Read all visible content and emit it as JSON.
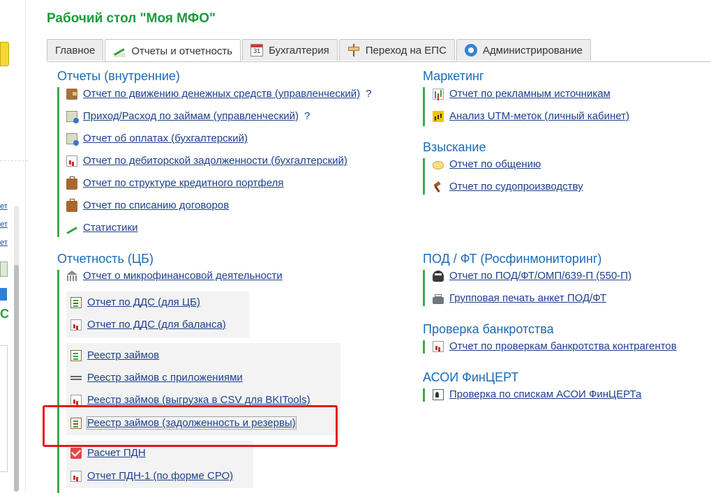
{
  "page_title": "Рабочий стол \"Моя МФО\"",
  "sidebar_fragments": [
    "ет",
    "ет",
    "ет"
  ],
  "tabs": [
    {
      "label": "Главное",
      "icon": "",
      "active": false
    },
    {
      "label": "Отчеты и отчетность",
      "icon": "chart-up-icon",
      "active": true
    },
    {
      "label": "Бухгалтерия",
      "icon": "calendar-icon",
      "active": false
    },
    {
      "label": "Переход на ЕПС",
      "icon": "signpost-icon",
      "active": false
    },
    {
      "label": "Администрирование",
      "icon": "gear-icon",
      "active": false
    }
  ],
  "sections": {
    "internal": {
      "title": "Отчеты (внутренние)",
      "items": [
        {
          "label": "Отчет по движению денежных средств (управленческий)",
          "help": "?",
          "icon": "wallet-icon"
        },
        {
          "label": "Приход/Расход по займам (управленческий)",
          "help": "?",
          "icon": "money-icon"
        },
        {
          "label": "Отчет об оплатах (бухгалтерский)",
          "icon": "money-icon"
        },
        {
          "label": "Отчет по дебиторской задолженности (бухгалтерский)",
          "icon": "report-doc-icon"
        },
        {
          "label": "Отчет по структуре кредитного портфеля",
          "icon": "briefcase-icon"
        },
        {
          "label": "Отчет по списанию договоров",
          "icon": "briefcase-icon"
        },
        {
          "label": "Статистики",
          "icon": "chart-up-icon"
        }
      ]
    },
    "cb": {
      "title": "Отчетность (ЦБ)",
      "items": [
        {
          "label": "Отчет о микрофинансовой деятельности",
          "icon": "bank-icon"
        },
        {
          "label": "Отчет по ДДС (для ЦБ)",
          "icon": "clipboard-icon"
        },
        {
          "label": "Отчет по ДДС (для баланса)",
          "icon": "report-doc-icon"
        },
        {
          "label": "Реестр займов",
          "icon": "clipboard-check-icon"
        },
        {
          "label": "Реестр займов с приложениями",
          "icon": "lines-icon"
        },
        {
          "label": "Реестр займов (выгрузка в CSV для BKITools)",
          "icon": "report-doc-icon"
        },
        {
          "label": "Реестр займов (задолженность и резервы)",
          "icon": "clipboard-icon"
        },
        {
          "label": "Расчет ПДН",
          "icon": "mail-check-icon"
        },
        {
          "label": "Отчет ПДН-1 (по форме СРО)",
          "icon": "report-doc-icon"
        }
      ]
    },
    "marketing": {
      "title": "Маркетинг",
      "items": [
        {
          "label": "Отчет по рекламным источникам",
          "icon": "bar-chart-icon"
        },
        {
          "label": "Анализ UTM-меток (личный кабинет)",
          "icon": "yellow-bar-chart-icon"
        }
      ]
    },
    "collection": {
      "title": "Взыскание",
      "items": [
        {
          "label": "Отчет по общению",
          "icon": "speech-bubble-icon"
        },
        {
          "label": "Отчет по судопроизводству",
          "icon": "gavel-icon"
        }
      ]
    },
    "aml": {
      "title": "ПОД / ФТ (Росфинмониторинг)",
      "items": [
        {
          "label": "Отчет по ПОД/ФТ/ОМП/639-П (550-П)",
          "icon": "spy-icon"
        },
        {
          "label": "Групповая печать анкет ПОД/ФТ",
          "icon": "printer-icon"
        }
      ]
    },
    "bankruptcy": {
      "title": "Проверка банкротства",
      "items": [
        {
          "label": "Отчет по проверкам банкротства контрагентов",
          "icon": "report-doc-icon"
        }
      ]
    },
    "asoi": {
      "title": "АСОИ ФинЦЕРТ",
      "items": [
        {
          "label": "Проверка по спискам АСОИ ФинЦЕРТа",
          "icon": "id-card-icon"
        }
      ]
    }
  },
  "colors": {
    "title_green": "#1e9a3c",
    "section_blue": "#1a6bb8",
    "link": "#1c3f8c",
    "accent_bar": "#3bab4a",
    "highlight": "#e8141c"
  }
}
